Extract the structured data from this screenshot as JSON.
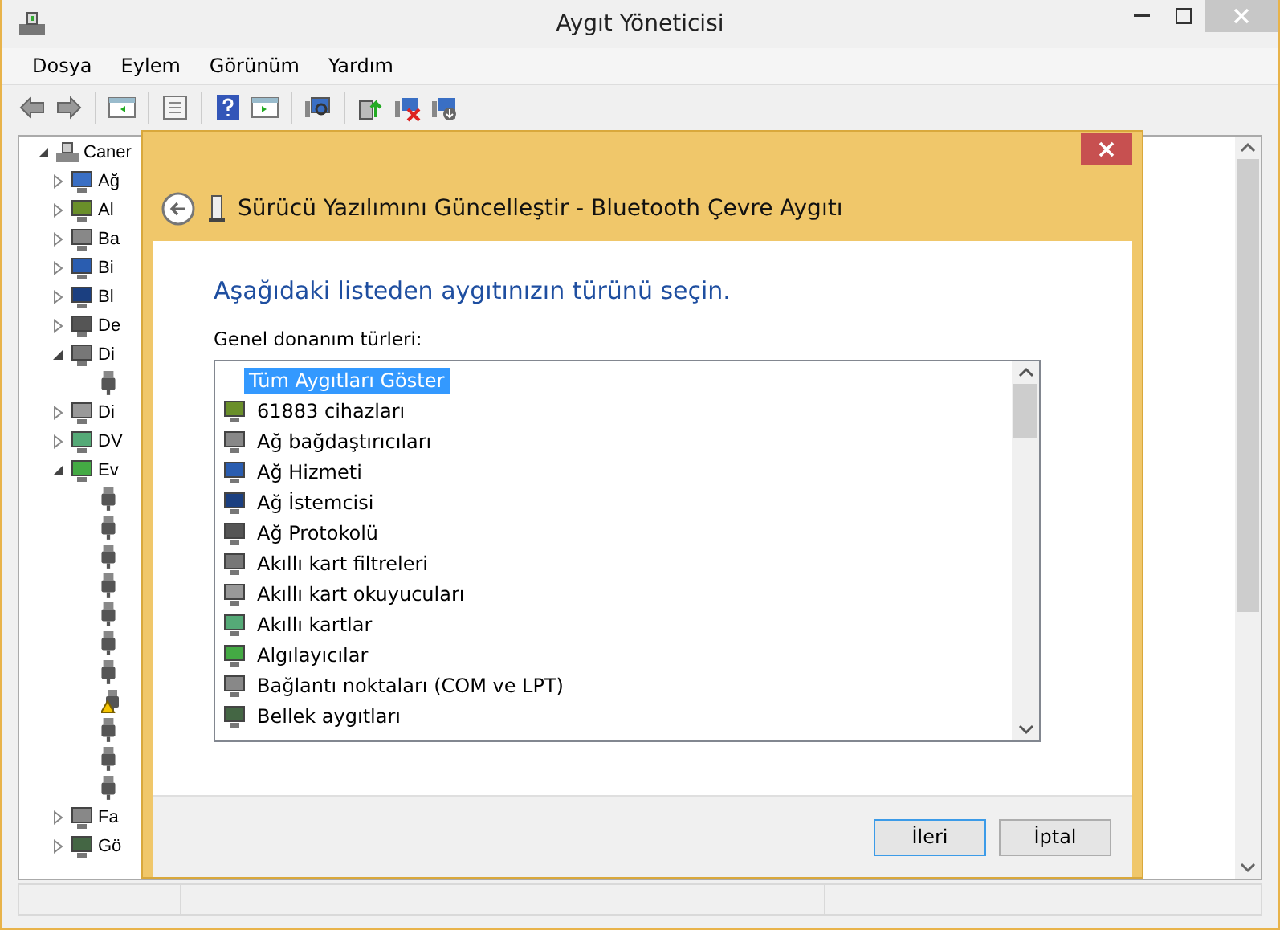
{
  "window": {
    "title": "Aygıt Yöneticisi"
  },
  "menu": [
    "Dosya",
    "Eylem",
    "Görünüm",
    "Yardım"
  ],
  "tree": {
    "label": "Caner",
    "expanded": true,
    "children": [
      {
        "label": "Ağ",
        "expanded": false
      },
      {
        "label": "Al",
        "expanded": false
      },
      {
        "label": "Ba",
        "expanded": false
      },
      {
        "label": "Bi",
        "expanded": false
      },
      {
        "label": "Bl",
        "expanded": false
      },
      {
        "label": "De",
        "expanded": false
      },
      {
        "label": "Di",
        "expanded": true,
        "children": [
          {
            "warning": false
          }
        ]
      },
      {
        "label": "Di",
        "expanded": false
      },
      {
        "label": "DV",
        "expanded": false
      },
      {
        "label": "Ev",
        "expanded": true,
        "children": [
          {
            "warning": false
          },
          {
            "warning": false
          },
          {
            "warning": false
          },
          {
            "warning": false
          },
          {
            "warning": false
          },
          {
            "warning": false
          },
          {
            "warning": false
          },
          {
            "warning": true
          },
          {
            "warning": false
          },
          {
            "warning": false
          },
          {
            "warning": false
          }
        ]
      },
      {
        "label": "Fa",
        "expanded": false
      },
      {
        "label": "Gö",
        "expanded": false
      }
    ]
  },
  "dialog": {
    "title": "Sürücü Yazılımını Güncelleştir - Bluetooth Çevre Aygıtı",
    "heading": "Aşağıdaki listeden aygıtınızın türünü seçin.",
    "list_label": "Genel donanım türleri:",
    "items": [
      {
        "label": "Tüm Aygıtları Göster",
        "kind": "all",
        "selected": true
      },
      {
        "label": "61883 cihazları",
        "kind": "category",
        "selected": false
      },
      {
        "label": "Ağ bağdaştırıcıları",
        "kind": "category",
        "selected": false
      },
      {
        "label": "Ağ Hizmeti",
        "kind": "category",
        "selected": false
      },
      {
        "label": "Ağ İstemcisi",
        "kind": "category",
        "selected": false
      },
      {
        "label": "Ağ Protokolü",
        "kind": "category",
        "selected": false
      },
      {
        "label": "Akıllı kart filtreleri",
        "kind": "category",
        "selected": false
      },
      {
        "label": "Akıllı kart okuyucuları",
        "kind": "category",
        "selected": false
      },
      {
        "label": "Akıllı kartlar",
        "kind": "category",
        "selected": false
      },
      {
        "label": "Algılayıcılar",
        "kind": "category",
        "selected": false
      },
      {
        "label": "Bağlantı noktaları (COM ve LPT)",
        "kind": "category",
        "selected": false
      },
      {
        "label": "Bellek aygıtları",
        "kind": "category",
        "selected": false
      }
    ],
    "buttons": [
      {
        "label": "İleri",
        "default": true
      },
      {
        "label": "İptal",
        "default": false
      }
    ]
  }
}
